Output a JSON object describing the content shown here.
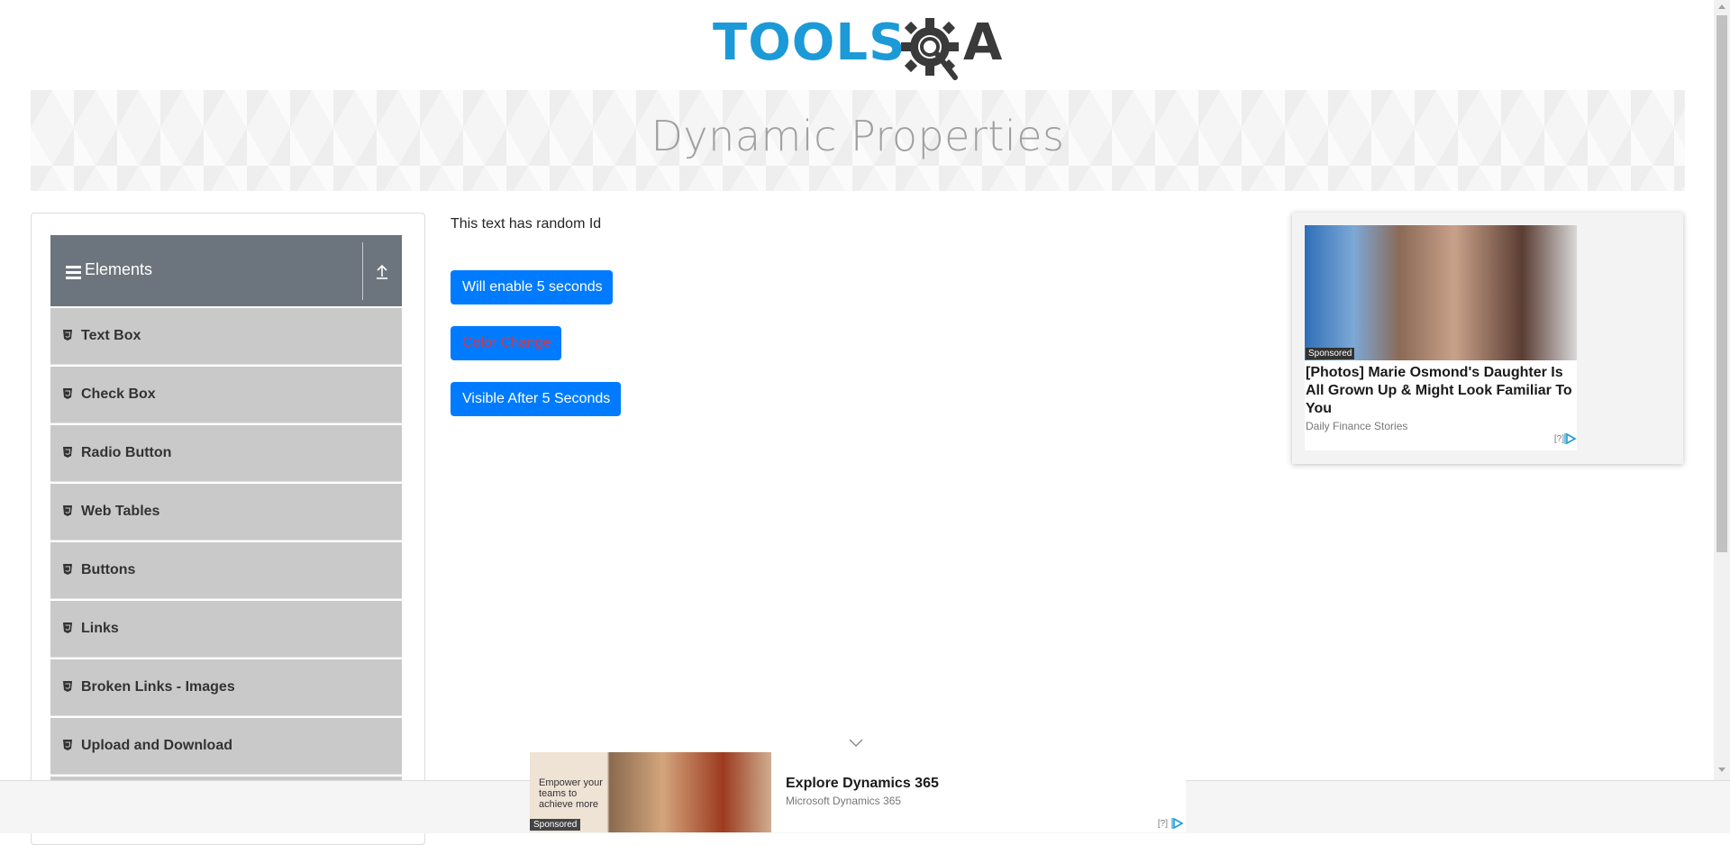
{
  "header": {
    "logo": {
      "text_a": "TOOLS",
      "text_b": "A",
      "alt": "ToolsQA"
    }
  },
  "banner": {
    "title": "Dynamic Properties"
  },
  "sidebar": {
    "group": {
      "title": "Elements"
    },
    "items": [
      {
        "label": "Text Box"
      },
      {
        "label": "Check Box"
      },
      {
        "label": "Radio Button"
      },
      {
        "label": "Web Tables"
      },
      {
        "label": "Buttons"
      },
      {
        "label": "Links"
      },
      {
        "label": "Broken Links - Images"
      },
      {
        "label": "Upload and Download"
      }
    ]
  },
  "main": {
    "random_text": "This text has random Id",
    "buttons": {
      "enable": "Will enable 5 seconds",
      "color_change": "Color Change",
      "visible_after": "Visible After 5 Seconds"
    },
    "colors": {
      "primary": "#007bff",
      "color_change_text": "#dc3545"
    }
  },
  "ad_right": {
    "sponsored": "Sponsored",
    "headline": "[Photos] Marie Osmond's Daughter Is All Grown Up & Might Look Familiar To You",
    "source": "Daily Finance Stories",
    "help": "[?]"
  },
  "ad_bottom": {
    "tagline": "Empower your teams to achieve more",
    "sponsored": "Sponsored",
    "title": "Explore Dynamics 365",
    "source": "Microsoft Dynamics 365",
    "help": "[?]"
  },
  "icons": {
    "menu": "hamburger-icon",
    "collapse": "upload-arrow-icon",
    "item": "html5-shield-icon",
    "ad_choices": "adchoices-icon",
    "chevron": "chevron-down-icon"
  }
}
